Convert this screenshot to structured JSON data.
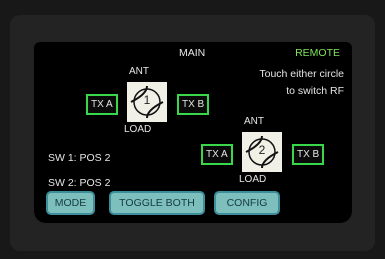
{
  "screen": {
    "title": "MAIN",
    "status_indicator": "REMOTE",
    "hint_line1": "Touch either circle",
    "hint_line2": "to switch RF",
    "status_sw1": "SW 1: POS 2",
    "status_sw2": "SW 2: POS 2"
  },
  "switches": [
    {
      "number": "1",
      "top_label": "ANT",
      "bottom_label": "LOAD",
      "left_port": "TX A",
      "right_port": "TX B"
    },
    {
      "number": "2",
      "top_label": "ANT",
      "bottom_label": "LOAD",
      "left_port": "TX A",
      "right_port": "TX B"
    }
  ],
  "buttons": {
    "mode": "MODE",
    "toggle_both": "TOGGLE BOTH",
    "config": "CONFIG"
  },
  "colors": {
    "accent_green": "#7fe35a",
    "port_border": "#39d74a",
    "button_fill": "#7dbfbd",
    "button_border": "#3d8e9a"
  }
}
